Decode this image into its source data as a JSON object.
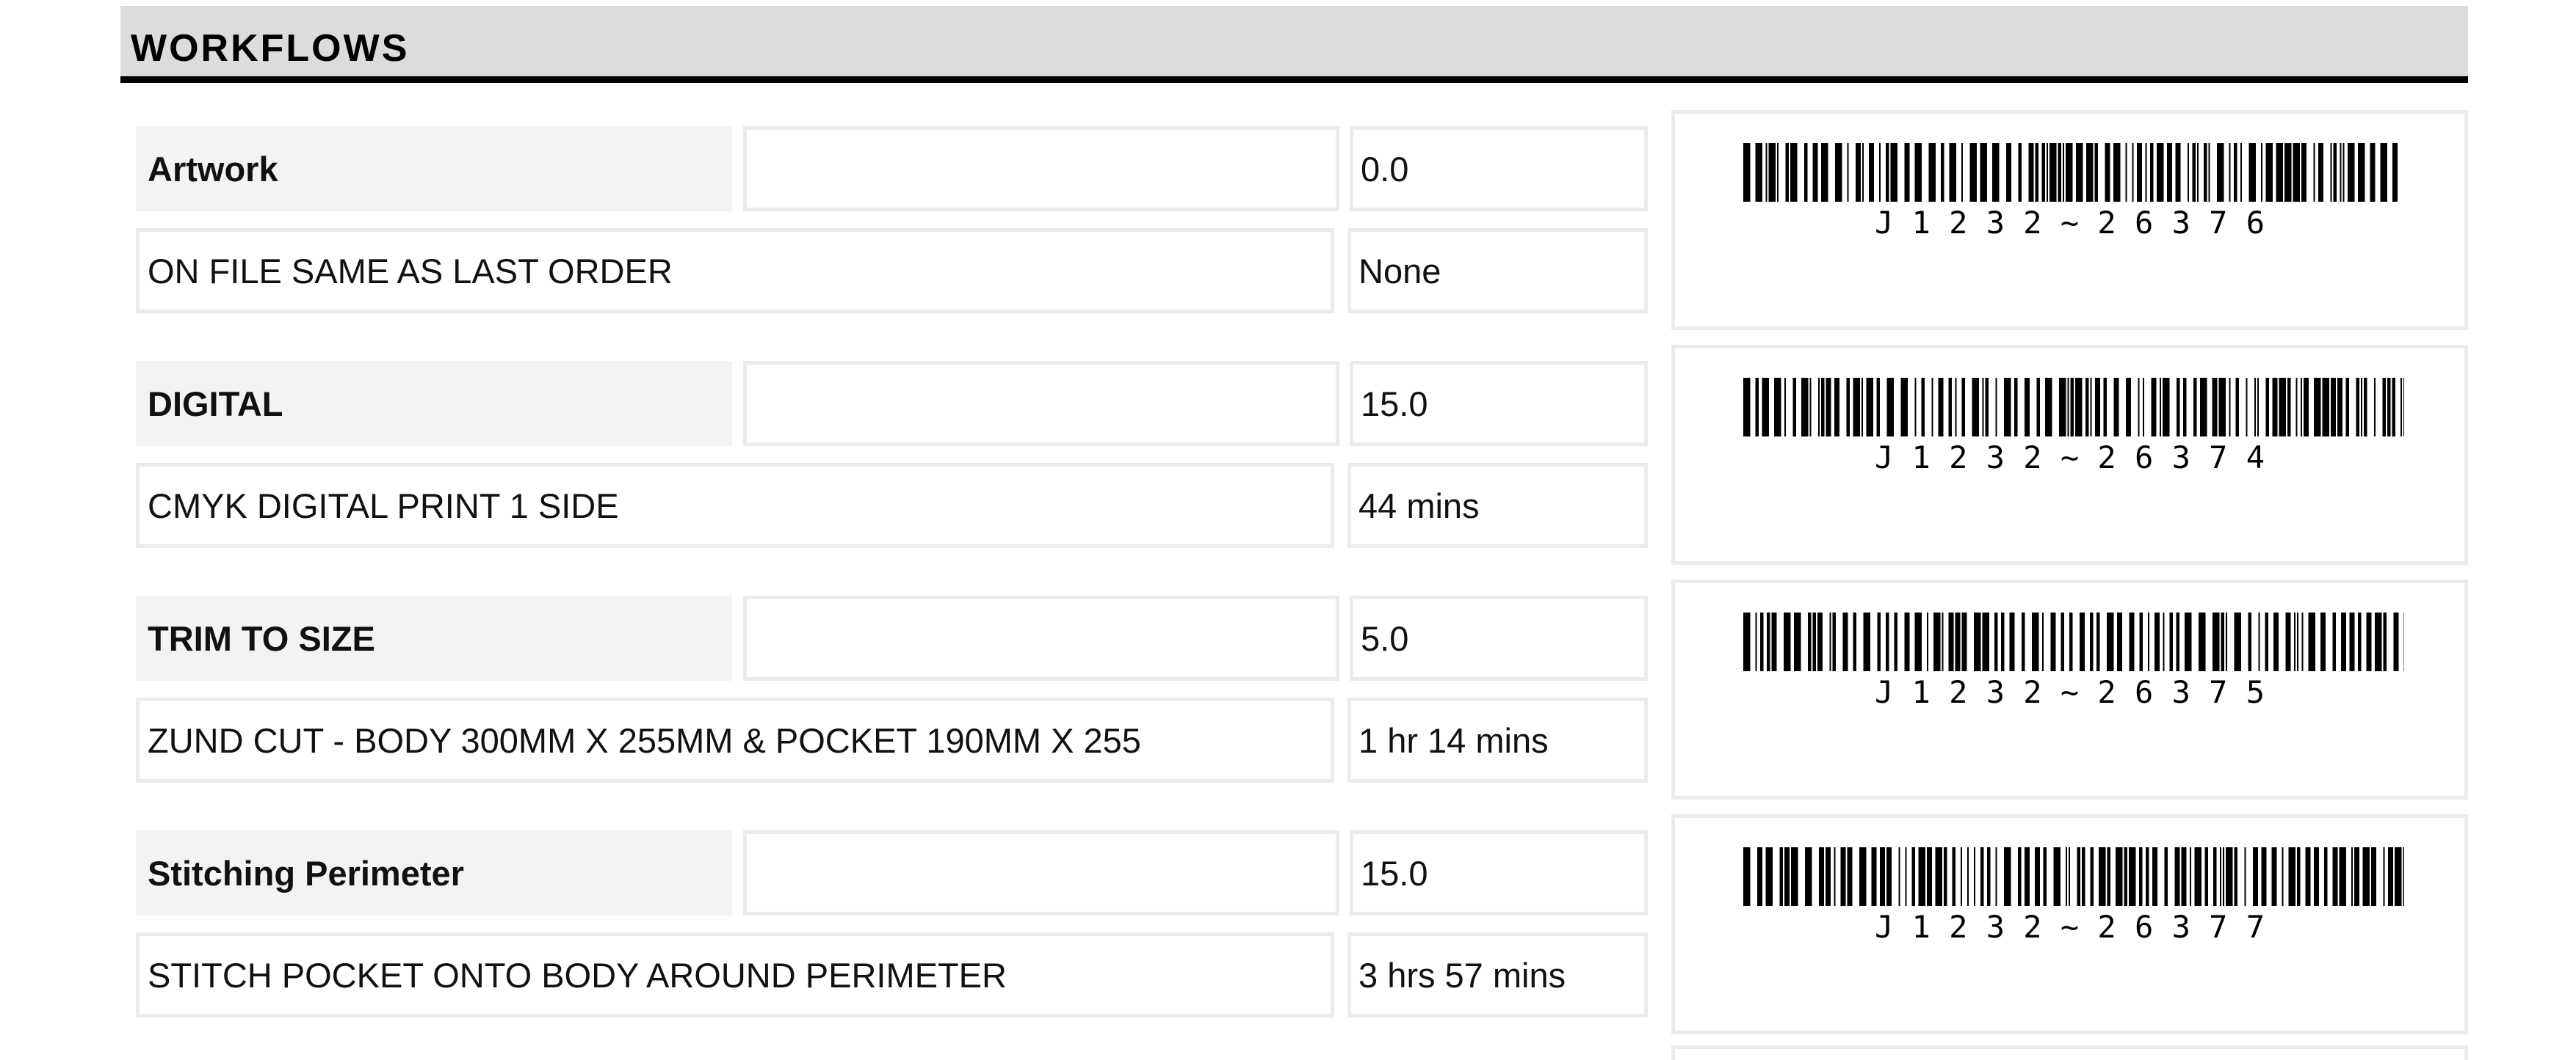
{
  "header": {
    "title": "WORKFLOWS"
  },
  "workflows": [
    {
      "title": "Artwork",
      "quantity": "0.0",
      "description": "ON FILE SAME AS LAST ORDER",
      "time": "None",
      "barcode": "J1232~26376"
    },
    {
      "title": "DIGITAL",
      "quantity": "15.0",
      "description": "CMYK DIGITAL PRINT 1 SIDE",
      "time": "44 mins",
      "barcode": "J1232~26374"
    },
    {
      "title": "TRIM TO SIZE",
      "quantity": "5.0",
      "description": "ZUND CUT - BODY 300MM X 255MM & POCKET 190MM X 255",
      "time": "1 hr 14 mins",
      "barcode": "J1232~26375"
    },
    {
      "title": "Stitching Perimeter",
      "quantity": "15.0",
      "description": "STITCH POCKET ONTO BODY AROUND PERIMETER",
      "time": "3 hrs 57 mins",
      "barcode": "J1232~26377"
    }
  ]
}
